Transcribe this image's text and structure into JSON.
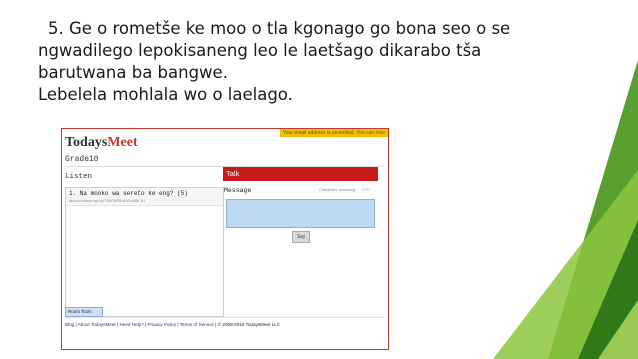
{
  "slide": {
    "line1": "5. Ge o rometše ke moo o tla kgonago go bona seo  o se",
    "line2": "ngwadilego lepokisaneng leo le laetšago dikarabo tša",
    "line3": "barutwana ba bangwe.",
    "line4": "Lebelela mohlala wo o laelago."
  },
  "app": {
    "logo_part1": "Todays",
    "logo_part2": "Meet",
    "banner": "Your email address is unverified. You can mov",
    "room_name": "Grade10",
    "listen_label": "Listen",
    "messages": [
      {
        "text": "1. Na mooko wa sereto ke eng? (5)",
        "meta": "about a minute ago by TEACHER-MACHABE RJ"
      }
    ],
    "room_tools_label": "Room Tools",
    "talk_label": "Talk",
    "message_label": "Message",
    "characters_remaining_label": "Characters remaining:",
    "characters_remaining_value": "140",
    "say_label": "Say",
    "footer": {
      "blog": "Blog",
      "about": "About TodaysMeet",
      "help": "Need Help?",
      "privacy": "Privacy Policy",
      "terms": "Terms of Service",
      "copyright": "© 2008-2015 TodaysMeet LLC",
      "separator": "|"
    }
  },
  "colors": {
    "green_dark": "#3e8f1f",
    "green_light": "#8dc63f",
    "talk_red": "#c71a1a",
    "banner_yellow": "#f2c200"
  }
}
